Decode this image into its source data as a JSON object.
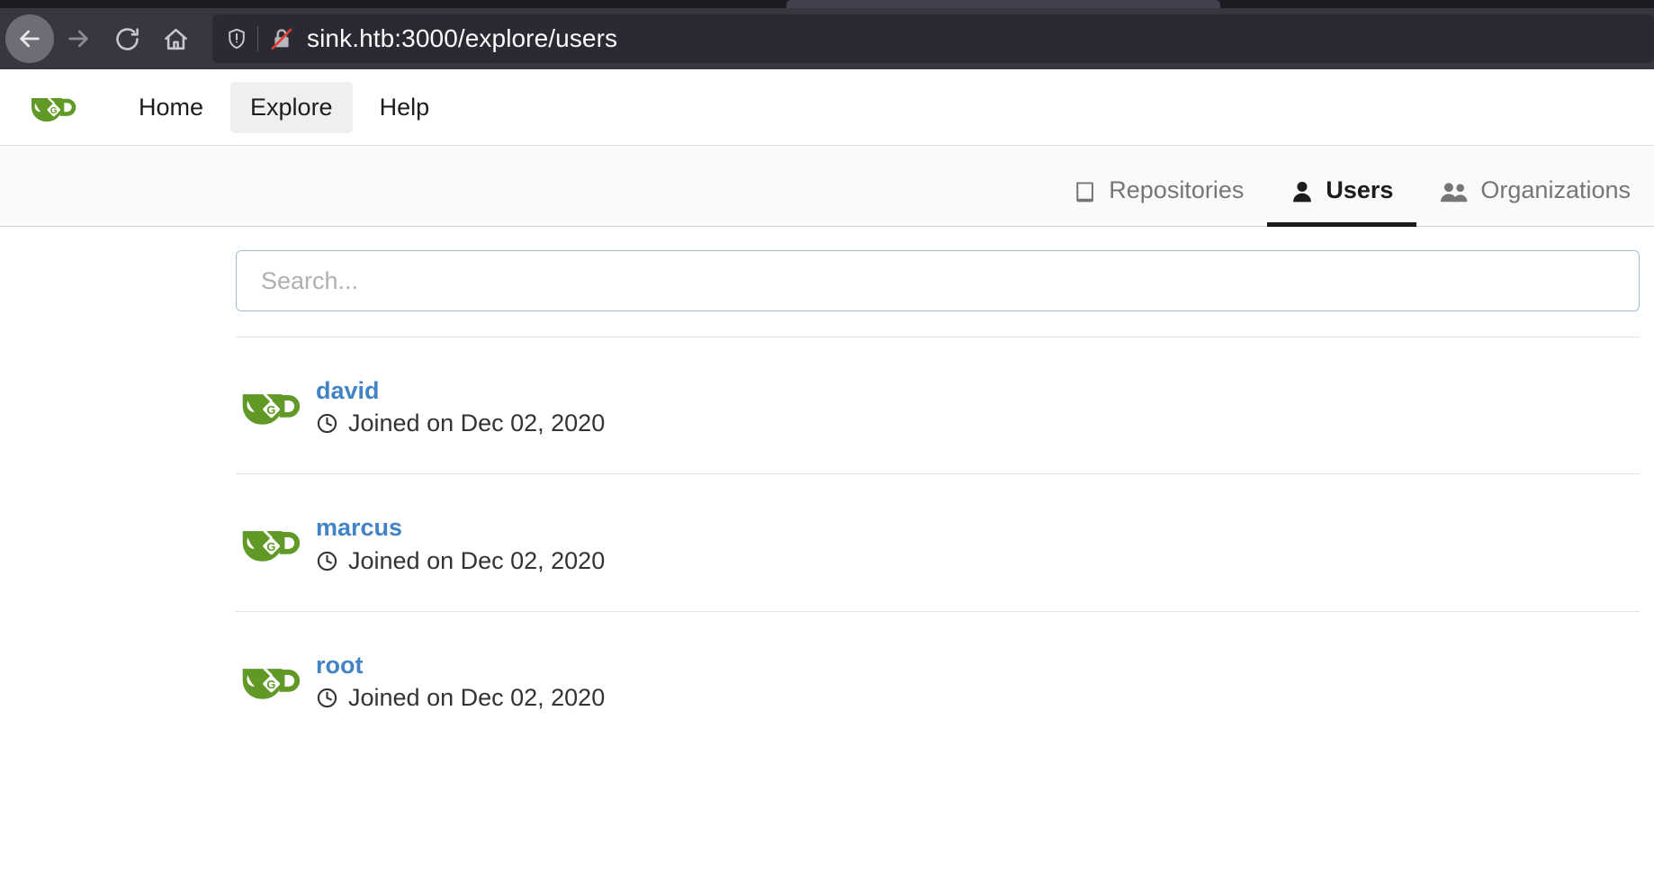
{
  "browser": {
    "url": "sink.htb:3000/explore/users",
    "back_icon": "back-arrow-icon",
    "forward_icon": "forward-arrow-icon",
    "reload_icon": "reload-icon",
    "home_icon": "home-icon",
    "shield_icon": "shield-icon",
    "lock_icon": "lock-insecure-icon"
  },
  "header": {
    "logo": "gitea-logo",
    "nav": [
      {
        "label": "Home",
        "active": false
      },
      {
        "label": "Explore",
        "active": true
      },
      {
        "label": "Help",
        "active": false
      }
    ]
  },
  "explore": {
    "tabs": [
      {
        "label": "Repositories",
        "icon": "repo-icon",
        "active": false
      },
      {
        "label": "Users",
        "icon": "user-icon",
        "active": true
      },
      {
        "label": "Organizations",
        "icon": "organization-icon",
        "active": false
      }
    ]
  },
  "search": {
    "value": "",
    "placeholder": "Search..."
  },
  "users": [
    {
      "name": "david",
      "joined": "Joined on Dec 02, 2020",
      "avatar": "gitea-avatar"
    },
    {
      "name": "marcus",
      "joined": "Joined on Dec 02, 2020",
      "avatar": "gitea-avatar"
    },
    {
      "name": "root",
      "joined": "Joined on Dec 02, 2020",
      "avatar": "gitea-avatar"
    }
  ],
  "colors": {
    "link": "#4183c4",
    "brand_green": "#609926",
    "chrome_bg": "#38373f",
    "urlbar_bg": "#2b2a33",
    "tab_inactive": "#767676"
  }
}
